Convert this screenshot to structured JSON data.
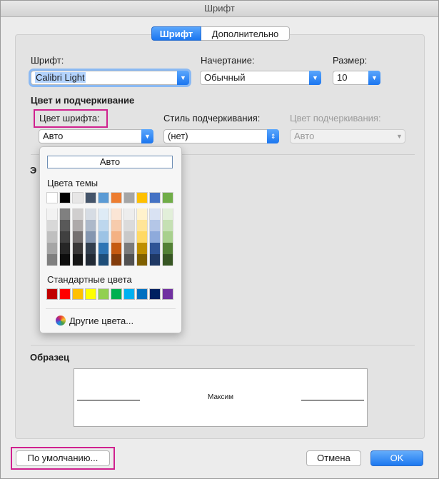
{
  "window": {
    "title": "Шрифт"
  },
  "tabs": [
    {
      "label": "Шрифт",
      "active": true
    },
    {
      "label": "Дополнительно",
      "active": false
    }
  ],
  "font": {
    "label": "Шрифт:",
    "value": "Calibri Light"
  },
  "style": {
    "label": "Начертание:",
    "value": "Обычный"
  },
  "size": {
    "label": "Размер:",
    "value": "10"
  },
  "color_section": {
    "title": "Цвет и подчеркивание"
  },
  "font_color": {
    "label": "Цвет шрифта:",
    "value": "Авто"
  },
  "underline_style": {
    "label": "Стиль подчеркивания:",
    "value": "(нет)"
  },
  "underline_color": {
    "label": "Цвет подчеркивания:",
    "value": "Авто",
    "disabled": true
  },
  "effects_section": {
    "title_partial": "Э"
  },
  "color_popup": {
    "auto_label": "Авто",
    "theme_label": "Цвета темы",
    "theme_base": [
      "#FFFFFF",
      "#000000",
      "#E7E6E6",
      "#44546A",
      "#5B9BD5",
      "#ED7D31",
      "#A5A5A5",
      "#FFC000",
      "#4472C4",
      "#70AD47"
    ],
    "theme_shades": [
      [
        "#F2F2F2",
        "#808080",
        "#D0CECE",
        "#D6DCE4",
        "#DEEBF6",
        "#FBE5D5",
        "#EDEDED",
        "#FFF2CC",
        "#D9E2F3",
        "#E2EFD9"
      ],
      [
        "#D8D8D8",
        "#595959",
        "#AEAAAA",
        "#ADB9CA",
        "#BDD7EE",
        "#F7CBAC",
        "#DBDBDB",
        "#FFE598",
        "#B4C6E7",
        "#C5E0B3"
      ],
      [
        "#BFBFBF",
        "#404040",
        "#757070",
        "#8496B0",
        "#9CC3E5",
        "#F4B183",
        "#C9C9C9",
        "#FFD965",
        "#8EAADB",
        "#A8D08D"
      ],
      [
        "#A5A5A5",
        "#262626",
        "#3A3838",
        "#323F4F",
        "#2E75B5",
        "#C55A11",
        "#7B7B7B",
        "#BF8F00",
        "#2F5496",
        "#538135"
      ],
      [
        "#7F7F7F",
        "#0D0D0D",
        "#161616",
        "#222A35",
        "#1E4E79",
        "#833C0B",
        "#525252",
        "#7F6000",
        "#1F3864",
        "#375623"
      ]
    ],
    "standard_label": "Стандартные цвета",
    "standard_colors": [
      "#C00000",
      "#FF0000",
      "#FFC000",
      "#FFFF00",
      "#92D050",
      "#00B050",
      "#00B0F0",
      "#0070C0",
      "#002060",
      "#7030A0"
    ],
    "more_colors_label": "Другие цвета..."
  },
  "preview": {
    "title": "Образец",
    "sample_text": "Максим"
  },
  "buttons": {
    "default_label": "По умолчанию...",
    "cancel_label": "Отмена",
    "ok_label": "OK"
  },
  "colors": {
    "accent": "#1B76F0",
    "highlight_border": "#D0218F"
  }
}
